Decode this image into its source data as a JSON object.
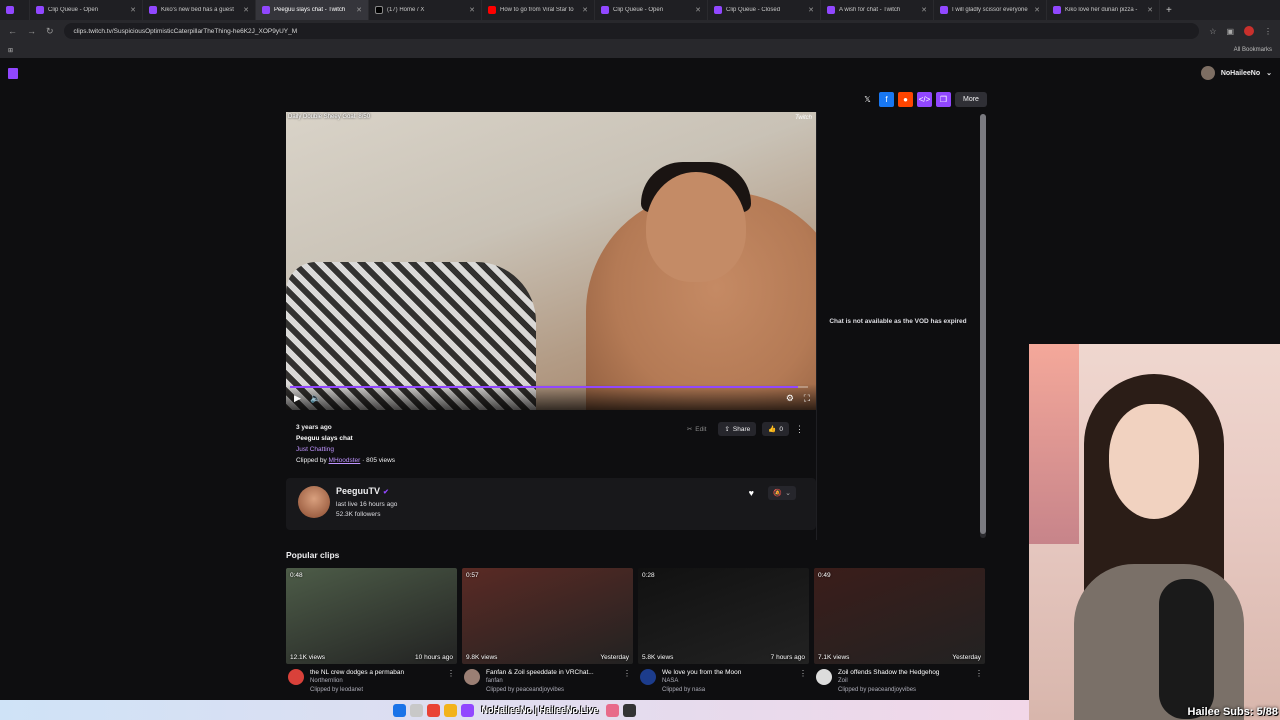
{
  "tabs": [
    {
      "label": "",
      "icon": "twitch-icon"
    },
    {
      "label": "Clip Queue - Open",
      "icon": "twitch-icon"
    },
    {
      "label": "Kiko's new bed has a guest",
      "icon": "twitch-icon"
    },
    {
      "label": "Peeguu slays chat - Twitch",
      "icon": "twitch-icon",
      "active": true
    },
    {
      "label": "(17) Home / X",
      "icon": "x-icon"
    },
    {
      "label": "How to go from Viral Star to",
      "icon": "youtube-icon"
    },
    {
      "label": "Clip Queue - Open",
      "icon": "twitch-icon"
    },
    {
      "label": "Clip Queue - Closed",
      "icon": "twitch-icon"
    },
    {
      "label": "A wish for chat - Twitch",
      "icon": "twitch-icon"
    },
    {
      "label": "I will gladly scissor everyone",
      "icon": "twitch-icon"
    },
    {
      "label": "Kiko love her durian pizza -",
      "icon": "twitch-icon"
    }
  ],
  "address": {
    "url": "clips.twitch.tv/SuspiciousOptimisticCaterpillarTheThing-he6K2J_XOP9yUY_M"
  },
  "bookmarks": {
    "all_label": "All Bookmarks"
  },
  "header": {
    "username": "NoHaileeNo"
  },
  "share": {
    "more_label": "More"
  },
  "player": {
    "overlay_text": "Daily Double Sheey Goal: 8/50",
    "watermark": "Twitch",
    "progress": 0.98
  },
  "chat": {
    "message": "Chat is not available as the VOD has expired"
  },
  "clip": {
    "ago": "3 years ago",
    "title": "Peeguu slays chat",
    "category": "Just Chatting",
    "clipped_prefix": "Clipped by",
    "clipper": "MHoodster",
    "views": "· 805 views",
    "edit_label": "Edit",
    "share_label": "Share",
    "likes": "0"
  },
  "channel": {
    "name": "PeeguuTV",
    "last_live": "last live 16 hours ago",
    "followers": "52.3K followers"
  },
  "popular": {
    "heading": "Popular clips",
    "clips": [
      {
        "duration": "0:48",
        "views": "12.1K views",
        "age": "10 hours ago",
        "title": "the NL crew dodges a permaban",
        "channel": "Northernlion",
        "clipped_by": "Clipped by leodanet",
        "thumb_color": "#4d5c48",
        "avatar_color": "#d9413a"
      },
      {
        "duration": "0:57",
        "views": "9.8K views",
        "age": "Yesterday",
        "title": "Fanfan & Zoil speeddate in VRChat...",
        "channel": "fanfan",
        "clipped_by": "Clipped by peaceandjoyvibes",
        "thumb_color": "#5a2a24",
        "avatar_color": "#9b7f74"
      },
      {
        "duration": "0:28",
        "views": "5.8K views",
        "age": "7 hours ago",
        "title": "We love you from the Moon",
        "channel": "NASA",
        "clipped_by": "Clipped by nasa",
        "thumb_color": "#111111",
        "avatar_color": "#1c3c8c"
      },
      {
        "duration": "0:49",
        "views": "7.1K views",
        "age": "Yesterday",
        "title": "Zoil offends Shadow the Hedgehog",
        "channel": "Zoil",
        "clipped_by": "Clipped by peaceandjoyvibes",
        "thumb_color": "#3b1d1a",
        "avatar_color": "#dcdcdc"
      }
    ]
  },
  "webcam": {
    "subs_text": "Hailee Subs: 5/88"
  },
  "taskbar": {
    "banner": "NoHaileeNo | HaileeNo.Live"
  },
  "colors": {
    "accent": "#9147ff",
    "background": "#0e0e10",
    "link": "#bf94ff"
  }
}
